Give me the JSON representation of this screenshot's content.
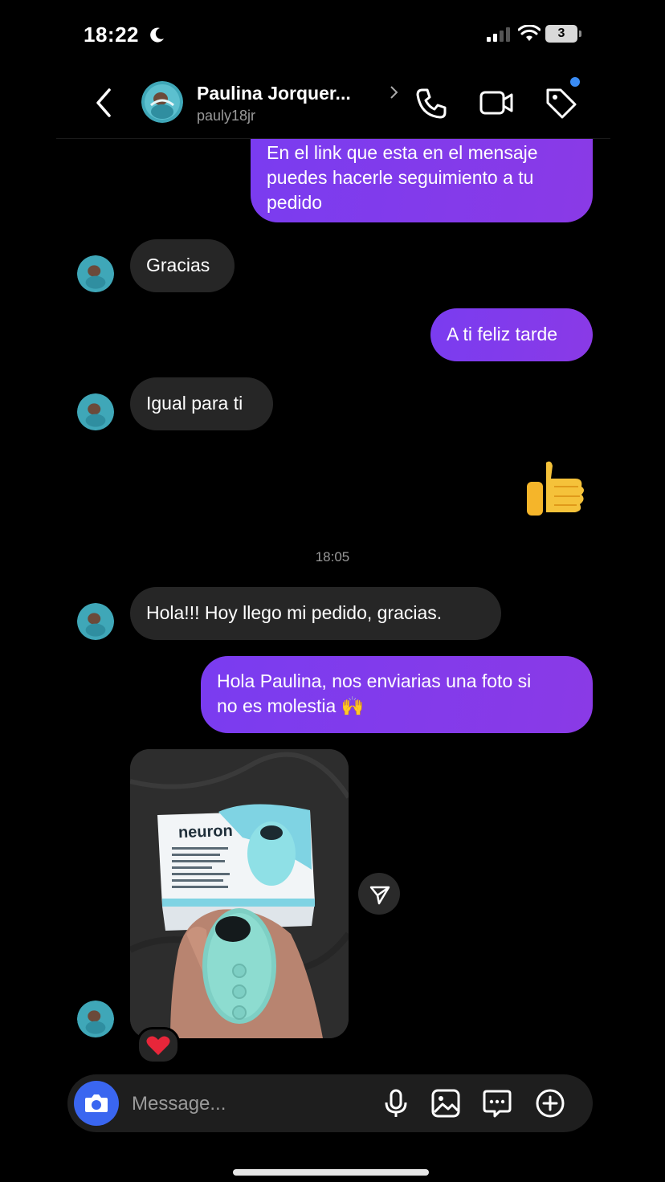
{
  "status_bar": {
    "time": "18:22",
    "battery": "3"
  },
  "header": {
    "name": "Paulina Jorquer...",
    "username": "pauly18jr"
  },
  "messages": [
    {
      "direction": "out",
      "lines": [
        "En el link que esta en el mensaje",
        "puedes hacerle seguimiento a tu",
        "pedido"
      ]
    },
    {
      "direction": "in",
      "text": "Gracias"
    },
    {
      "direction": "out",
      "text": "A ti feliz tarde"
    },
    {
      "direction": "in",
      "text": "Igual para ti"
    },
    {
      "direction": "out",
      "emoji": "👍"
    },
    {
      "direction": "in",
      "text": "Hola!!! Hoy llego mi pedido, gracias."
    },
    {
      "direction": "out",
      "lines": [
        "Hola Paulina, nos enviarias una foto si",
        "no es molestia 🙌"
      ]
    }
  ],
  "timestamp": "18:05",
  "photo": {
    "brand_text": "neuron",
    "reaction": "❤️"
  },
  "composer": {
    "placeholder": "Message..."
  },
  "colors": {
    "outgoing_bubble": "#7a3cf0",
    "incoming_bubble": "#262626",
    "camera_button": "#3a66f0",
    "notification_dot": "#3a8cf5"
  },
  "icons": [
    "back-chevron-icon",
    "phone-icon",
    "video-camera-icon",
    "tag-icon",
    "send-icon",
    "heart-icon",
    "camera-icon",
    "microphone-icon",
    "image-icon",
    "sticker-icon",
    "plus-circle-icon",
    "moon-icon",
    "signal-icon",
    "wifi-icon"
  ]
}
